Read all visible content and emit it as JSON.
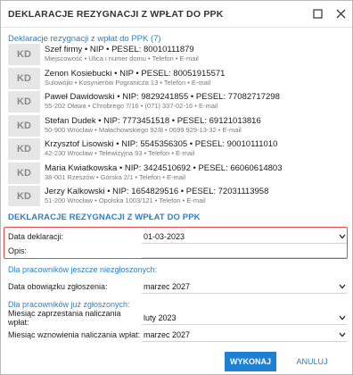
{
  "window": {
    "title": "DEKLARACJE REZYGNACJI Z WPŁAT DO PPK",
    "maximize_icon": "maximize-icon",
    "close_icon": "close-icon"
  },
  "list_section": {
    "title": "Deklaracje rezygnacji z wpłat do PPK (7)"
  },
  "employees": [
    {
      "initials": "KD",
      "main": "Szef firmy • NIP • PESEL: 80010111879",
      "sub": "Miejscowość • Ulica i numer domu • Telefon • E-mail"
    },
    {
      "initials": "KD",
      "main": "Zenon Kosiebucki • NIP • PESEL: 80051915571",
      "sub": "Sulowójki • Kosynierów Pogranicza 13 • Telefon • E-mail"
    },
    {
      "initials": "KD",
      "main": "Paweł Dawidowski • NIP: 9829241855 • PESEL: 77082717298",
      "sub": "55-202 Oława • Chrobrego 7/16 • (071) 337-02-16 • E-mail"
    },
    {
      "initials": "KD",
      "main": "Stefan Dudek • NIP: 7773451518 • PESEL: 69121013816",
      "sub": "50-900 Wrocław • Małachowskiego 92/8 • 0699 929-13-32 • E-mail"
    },
    {
      "initials": "KD",
      "main": "Krzysztof Lisowski • NIP: 5545356305 • PESEL: 90010111010",
      "sub": "42-230 Wrocław • Telewizyjna 93 • Telefon • E-mail"
    },
    {
      "initials": "KD",
      "main": "Maria Kwiatkowska • NIP: 3424510692 • PESEL: 66060614803",
      "sub": "38-001 Rzeszów • Górska 2/1 • Telefon • E-mail"
    },
    {
      "initials": "KD",
      "main": "Jerzy Kalkowski • NIP: 1654829516 • PESEL: 72031113958",
      "sub": "51-200 Wrocław • Opolska 1003/121 • Telefon • E-mail"
    }
  ],
  "form_section": {
    "title": "DEKLARACJE REZYGNACJI Z WPŁAT DO PPK",
    "declaration_date_label": "Data deklaracji:",
    "declaration_date_value": "01-03-2023",
    "description_label": "Opis:",
    "description_value": "",
    "not_registered_header": "Dla pracowników jeszcze niezgłoszonych:",
    "obligation_date_label": "Data obowiązku zgłoszenia:",
    "obligation_date_value": "marzec 2027",
    "registered_header": "Dla pracowników już zgłoszonych:",
    "stop_month_label": "Miesiąc zaprzestania naliczania wpłat:",
    "stop_month_value": "luty 2023",
    "resume_month_label": "Miesiąc wznowienia naliczania wpłat:",
    "resume_month_value": "marzec 2027"
  },
  "buttons": {
    "confirm": "WYKONAJ",
    "cancel": "ANULUJ"
  },
  "colors": {
    "accent": "#2f7fc1",
    "primary_button": "#1f7fd0",
    "highlight_frame": "#e24a4a",
    "initials_bg": "#e6e6e6"
  }
}
